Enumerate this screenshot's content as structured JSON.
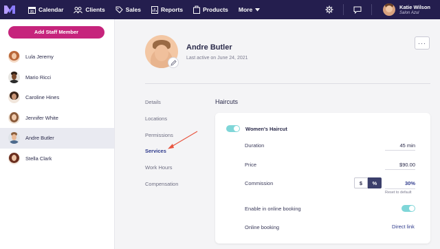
{
  "nav": {
    "items": [
      {
        "label": "Calendar",
        "icon": "calendar-icon"
      },
      {
        "label": "Clients",
        "icon": "clients-icon"
      },
      {
        "label": "Sales",
        "icon": "tag-icon"
      },
      {
        "label": "Reports",
        "icon": "reports-icon"
      },
      {
        "label": "Products",
        "icon": "products-icon"
      },
      {
        "label": "More",
        "icon": "chevron-down-icon"
      }
    ],
    "user": {
      "name": "Katie Wilson",
      "salon": "Salon Azul"
    }
  },
  "sidebar": {
    "add_button": "Add Staff Member",
    "staff": [
      {
        "name": "Lula Jeremy"
      },
      {
        "name": "Mario Ricci"
      },
      {
        "name": "Caroline Hines"
      },
      {
        "name": "Jennifer White"
      },
      {
        "name": "Andre Butler"
      },
      {
        "name": "Stella Clark"
      }
    ],
    "active": "Andre Butler"
  },
  "profile": {
    "name": "Andre Butler",
    "last_active": "Last active on June 24, 2021",
    "more": "···"
  },
  "subnav": [
    "Details",
    "Locations",
    "Permissions",
    "Services",
    "Work Hours",
    "Compensation"
  ],
  "subnav_active": "Services",
  "section": {
    "title": "Haircuts",
    "service": {
      "name": "Women's Haircut",
      "enabled": true,
      "duration_label": "Duration",
      "duration_value": "45 min",
      "price_label": "Price",
      "price_value": "$90.00",
      "commission_label": "Commission",
      "commission_dollar": "$",
      "commission_percent": "%",
      "commission_value": "30%",
      "reset_label": "Reset to default",
      "online_label": "Enable in online booking",
      "online_enabled": true,
      "booking_label": "Online booking",
      "booking_link": "Direct link"
    }
  },
  "colors": {
    "topnav": "#241e4e",
    "accent": "#c6247c",
    "toggle": "#7fd6d8",
    "link": "#2e3a8c",
    "arrow": "#e8553f"
  }
}
